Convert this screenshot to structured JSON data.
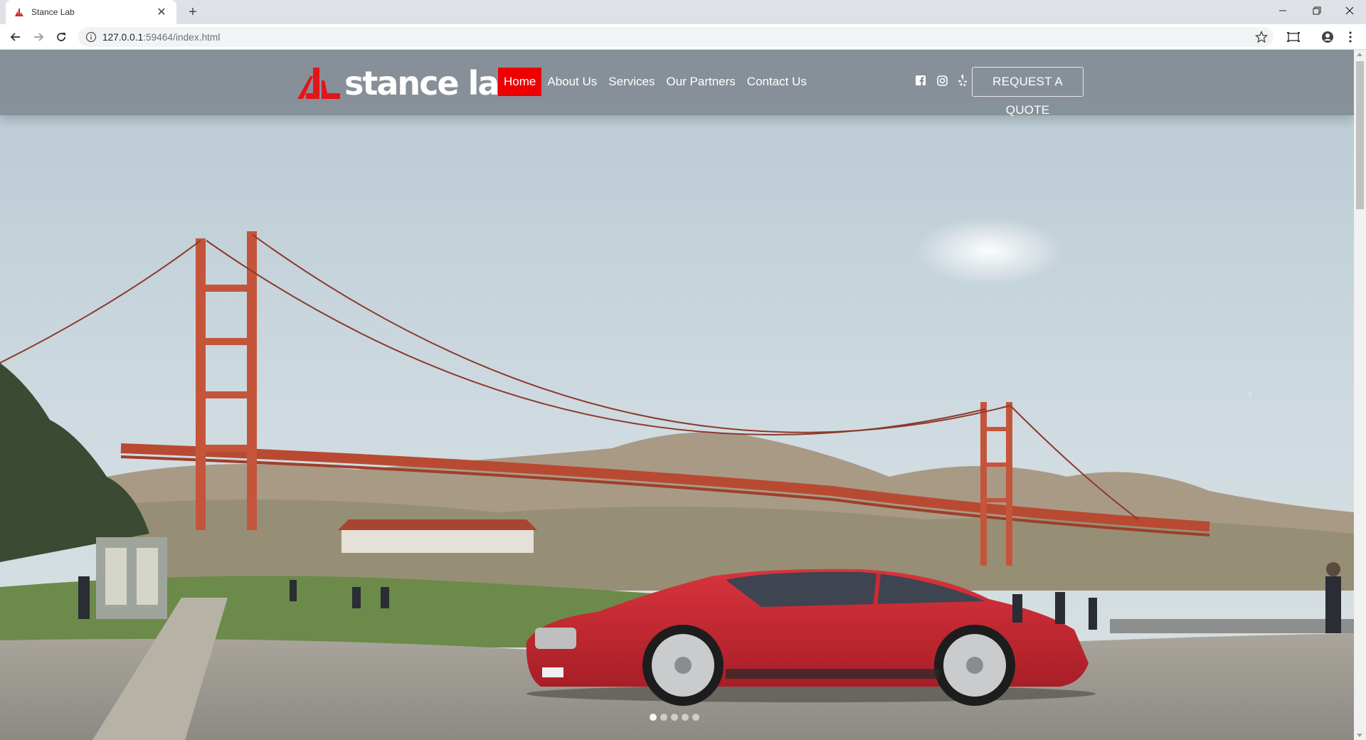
{
  "browser": {
    "tab_title": "Stance Lab",
    "url_host": "127.0.0.1",
    "url_rest": ":59464/index.html"
  },
  "site": {
    "logo_text": "stance lab",
    "nav": [
      {
        "label": "Home",
        "active": true
      },
      {
        "label": "About Us",
        "active": false
      },
      {
        "label": "Services",
        "active": false
      },
      {
        "label": "Our Partners",
        "active": false
      },
      {
        "label": "Contact Us",
        "active": false
      }
    ],
    "social_icons": [
      "facebook-icon",
      "instagram-icon",
      "yelp-icon"
    ],
    "quote_button": "REQUEST A QUOTE",
    "carousel": {
      "slides": 5,
      "active_index": 0
    }
  },
  "colors": {
    "accent_red": "#ee0000",
    "header_overlay": "#7a8189",
    "sky": "#c9d6de",
    "bridge": "#c8553d",
    "car": "#c92a34"
  }
}
